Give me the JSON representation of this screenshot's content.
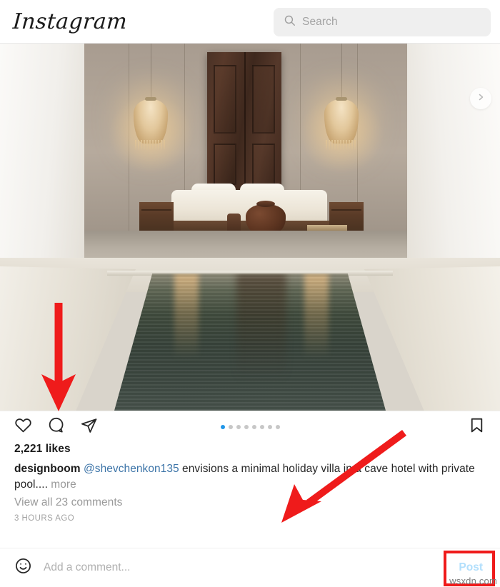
{
  "app": {
    "name": "Instagram",
    "logo_text": "Instagram"
  },
  "header": {
    "logo": "Instagram",
    "search": {
      "placeholder": "Search",
      "value": "",
      "icon": "search-icon"
    }
  },
  "post": {
    "photo_alt": "Minimal holiday villa interior in a cave hotel with a private pool",
    "carousel": {
      "total_dots": 8,
      "active_index": 0,
      "next_icon": "chevron-right-icon"
    },
    "actions": {
      "like": {
        "icon": "heart-icon",
        "label": "Like"
      },
      "comment": {
        "icon": "comment-icon",
        "label": "Comment"
      },
      "share": {
        "icon": "share-icon",
        "label": "Share"
      },
      "save": {
        "icon": "bookmark-icon",
        "label": "Save"
      }
    },
    "likes_text": "2,221 likes",
    "caption": {
      "username": "designboom",
      "mention": "@shevchenkon135",
      "body": " envisions a minimal holiday villa in a cave hotel with private pool....",
      "more": "more"
    },
    "view_comments": "View all 23 comments",
    "timestamp": "3 HOURS AGO"
  },
  "comment_bar": {
    "emoji_icon": "emoji-smiley-icon",
    "input_placeholder": "Add a comment...",
    "input_value": "",
    "post_label": "Post"
  },
  "watermark": "wsxdn.com",
  "colors": {
    "accent_blue": "#2196e8",
    "post_disabled": "#b2dffc",
    "annotation_red": "#ef1b1b",
    "search_bg": "#efefef",
    "muted_text": "#9a9a9a"
  },
  "annotations": [
    {
      "name": "arrow-to-comment-icon",
      "type": "arrow",
      "direction": "down"
    },
    {
      "name": "arrow-to-post-button",
      "type": "arrow",
      "direction": "down-left"
    },
    {
      "name": "post-button-highlight",
      "type": "rectangle"
    }
  ]
}
